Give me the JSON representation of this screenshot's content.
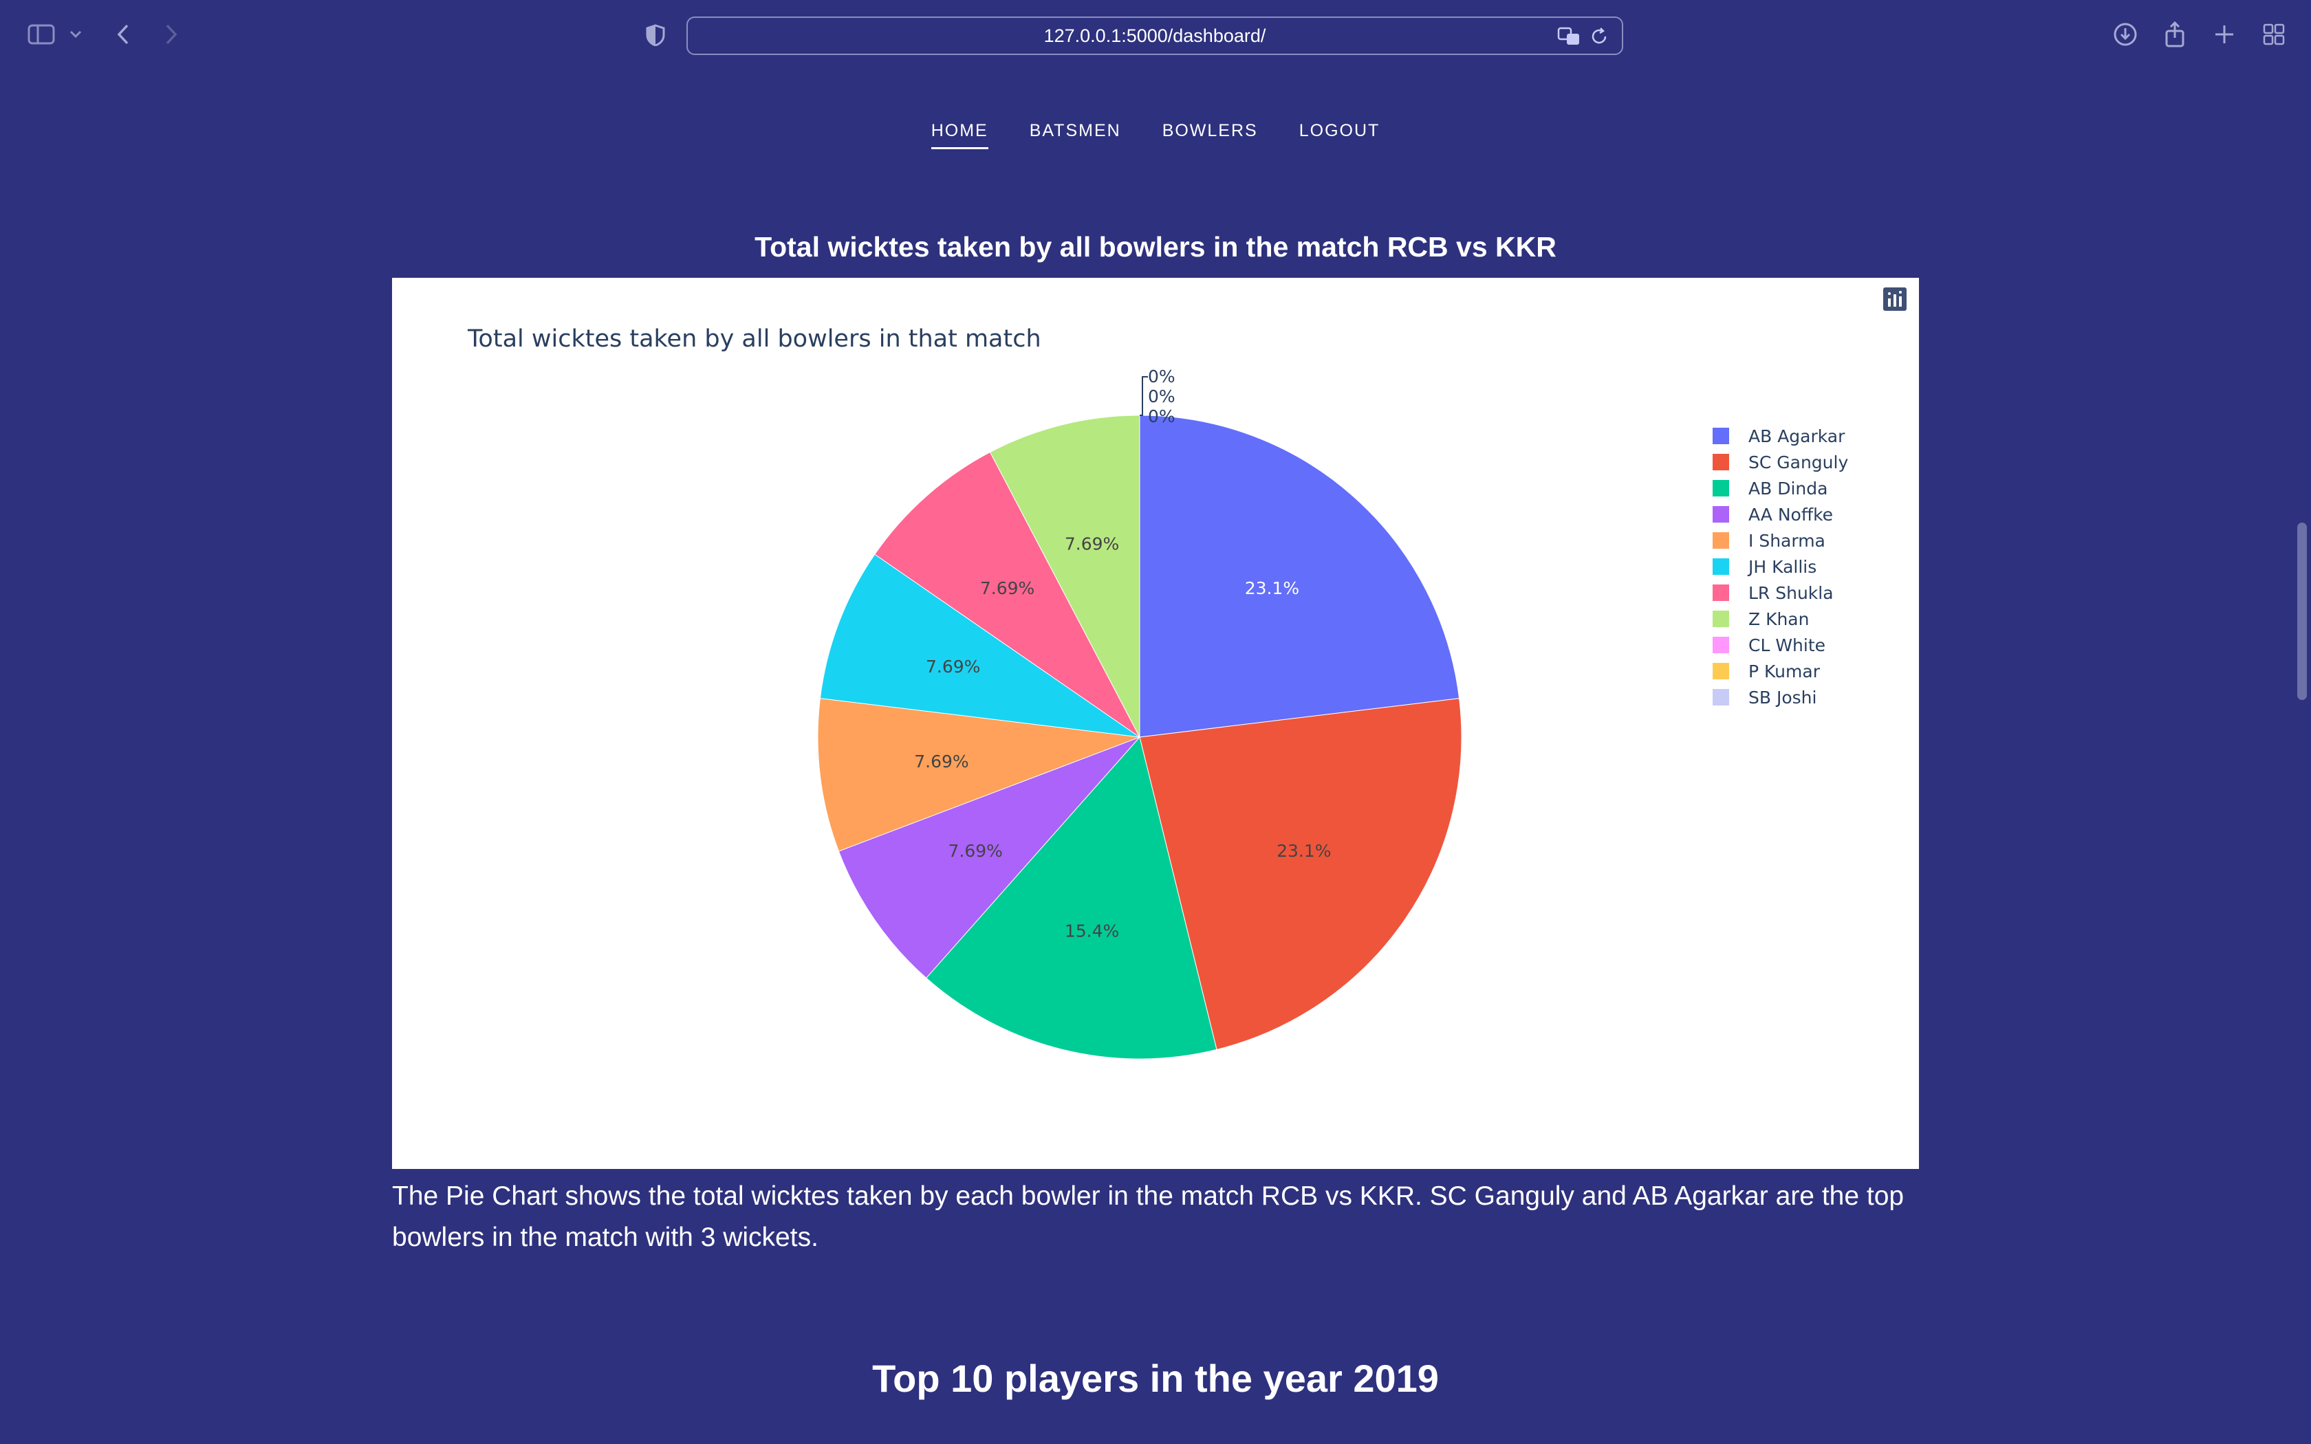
{
  "browser": {
    "url": "127.0.0.1:5000/dashboard/"
  },
  "nav": {
    "items": [
      {
        "label": "HOME",
        "active": true
      },
      {
        "label": "BATSMEN",
        "active": false
      },
      {
        "label": "BOWLERS",
        "active": false
      },
      {
        "label": "LOGOUT",
        "active": false
      }
    ]
  },
  "section": {
    "heading": "Total wicktes taken by all bowlers in the match RCB vs KKR",
    "caption": "The Pie Chart shows the total wicktes taken by each bowler in the match RCB vs KKR. SC Ganguly and AB Agarkar are the top bowlers in the match with 3 wickets.",
    "next_title": "Top 10 players in the year 2019"
  },
  "chart_data": {
    "type": "pie",
    "title": "Total wicktes taken by all bowlers in that match",
    "legend_position": "right",
    "slices": [
      {
        "label": "AB Agarkar",
        "value": 3,
        "pct_label": "23.1%",
        "color": "#636efa",
        "text_color": "#ffffff"
      },
      {
        "label": "SC Ganguly",
        "value": 3,
        "pct_label": "23.1%",
        "color": "#ef553b",
        "text_color": "#444444"
      },
      {
        "label": "AB Dinda",
        "value": 2,
        "pct_label": "15.4%",
        "color": "#00cc96",
        "text_color": "#444444"
      },
      {
        "label": "AA Noffke",
        "value": 1,
        "pct_label": "7.69%",
        "color": "#ab63fa",
        "text_color": "#444444"
      },
      {
        "label": "I Sharma",
        "value": 1,
        "pct_label": "7.69%",
        "color": "#ffa15a",
        "text_color": "#444444"
      },
      {
        "label": "JH Kallis",
        "value": 1,
        "pct_label": "7.69%",
        "color": "#19d3f3",
        "text_color": "#444444"
      },
      {
        "label": "LR Shukla",
        "value": 1,
        "pct_label": "7.69%",
        "color": "#ff6692",
        "text_color": "#444444"
      },
      {
        "label": "Z Khan",
        "value": 1,
        "pct_label": "7.69%",
        "color": "#b6e880",
        "text_color": "#444444"
      },
      {
        "label": "CL White",
        "value": 0,
        "pct_label": "0%",
        "color": "#ff97ff",
        "text_color": "#444444"
      },
      {
        "label": "P Kumar",
        "value": 0,
        "pct_label": "0%",
        "color": "#fecb52",
        "text_color": "#444444"
      },
      {
        "label": "SB Joshi",
        "value": 0,
        "pct_label": "0%",
        "color": "#c8cbf5",
        "text_color": "#444444"
      }
    ]
  }
}
